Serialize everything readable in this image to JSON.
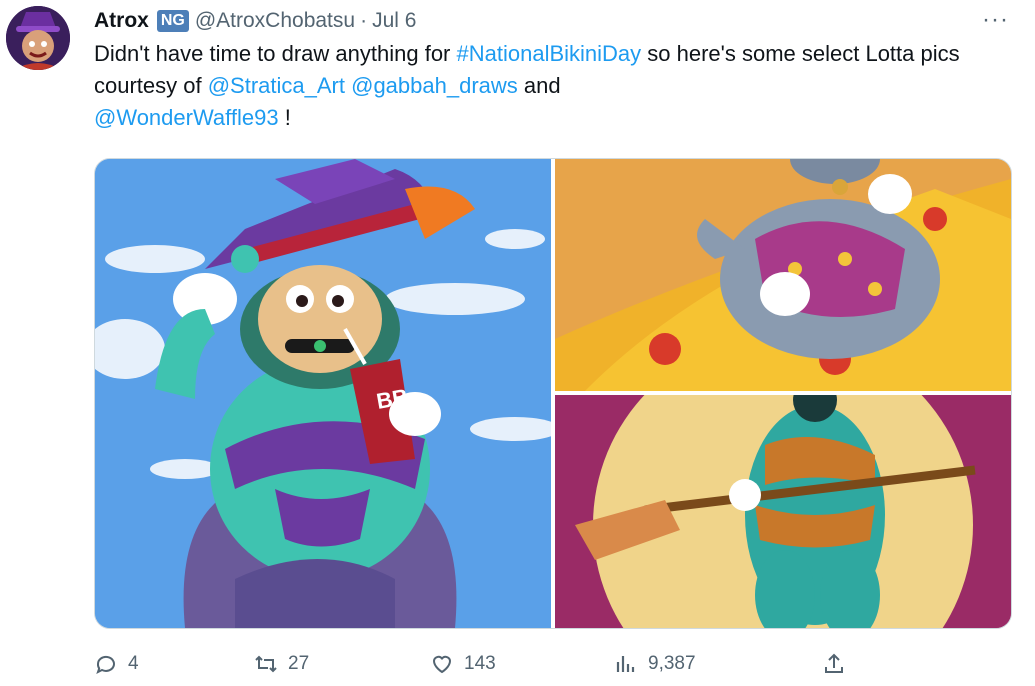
{
  "tweet": {
    "author_name": "Atrox",
    "badge": "NG",
    "handle": "@AtroxChobatsu",
    "separator": "·",
    "date": "Jul 6",
    "more": "···",
    "text": {
      "part1": "Didn't have time to draw anything for ",
      "hashtag": "#NationalBikiniDay",
      "part2": " so here's some select Lotta pics courtesy of ",
      "mention1": "@Stratica_Art",
      "space": " ",
      "mention2": "@gabbah_draws",
      "part3": " and ",
      "mention3": "@WonderWaffle93",
      "part4": " !"
    },
    "images": [
      {
        "subject": "witch-hat-bear-drinking"
      },
      {
        "subject": "character-on-pizza-float"
      },
      {
        "subject": "character-with-broom-moon"
      }
    ],
    "cup_text": "BB",
    "actions": {
      "replies": "4",
      "retweets": "27",
      "likes": "143",
      "views": "9,387"
    }
  },
  "colors": {
    "link": "#1d9bf0",
    "muted": "#536471",
    "text": "#0f1419",
    "badge": "#4d7fb8"
  }
}
